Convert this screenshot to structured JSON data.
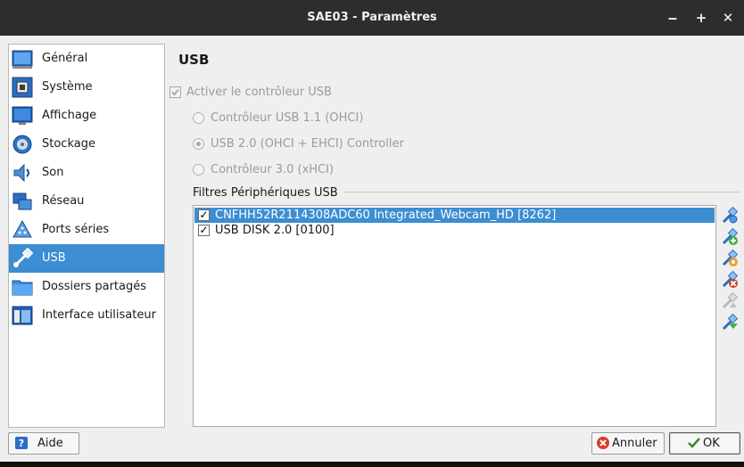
{
  "window": {
    "title": "SAE03 - Paramètres",
    "controls": [
      "‒",
      "+",
      "✕"
    ]
  },
  "sidebar": {
    "items": [
      {
        "label": "Général",
        "icon": "general-icon"
      },
      {
        "label": "Système",
        "icon": "system-icon"
      },
      {
        "label": "Affichage",
        "icon": "display-icon"
      },
      {
        "label": "Stockage",
        "icon": "storage-icon"
      },
      {
        "label": "Son",
        "icon": "audio-icon"
      },
      {
        "label": "Réseau",
        "icon": "network-icon"
      },
      {
        "label": "Ports séries",
        "icon": "serial-ports-icon"
      },
      {
        "label": "USB",
        "icon": "usb-icon",
        "selected": true
      },
      {
        "label": "Dossiers partagés",
        "icon": "shared-folders-icon"
      },
      {
        "label": "Interface utilisateur",
        "icon": "user-interface-icon"
      }
    ]
  },
  "usb": {
    "heading": "USB",
    "enable_label": "Activer le contrôleur USB",
    "enable_checked": true,
    "options": [
      {
        "label": "Contrôleur USB 1.1 (OHCI)",
        "selected": false
      },
      {
        "label": "USB 2.0 (OHCI + EHCI) Controller",
        "selected": true
      },
      {
        "label": "Contrôleur 3.0 (xHCI)",
        "selected": false
      }
    ],
    "filters_label": "Filtres Périphériques USB",
    "filters": [
      {
        "name": "CNFHH52R2114308ADC60 Integrated_Webcam_HD [8262]",
        "checked": true,
        "selected": true
      },
      {
        "name": "USB DISK 2.0 [0100]",
        "checked": true,
        "selected": false
      }
    ],
    "toolbar": [
      "usb-filter-icon",
      "add-filter-icon",
      "edit-filter-icon",
      "remove-filter-icon",
      "move-up-icon",
      "move-down-icon"
    ]
  },
  "buttons": {
    "help": "Aide",
    "cancel": "Annuler",
    "ok": "OK"
  },
  "colors": {
    "selection": "#3c8dd2",
    "titlebar": "#2d2d2d",
    "window_bg": "#efefef"
  }
}
